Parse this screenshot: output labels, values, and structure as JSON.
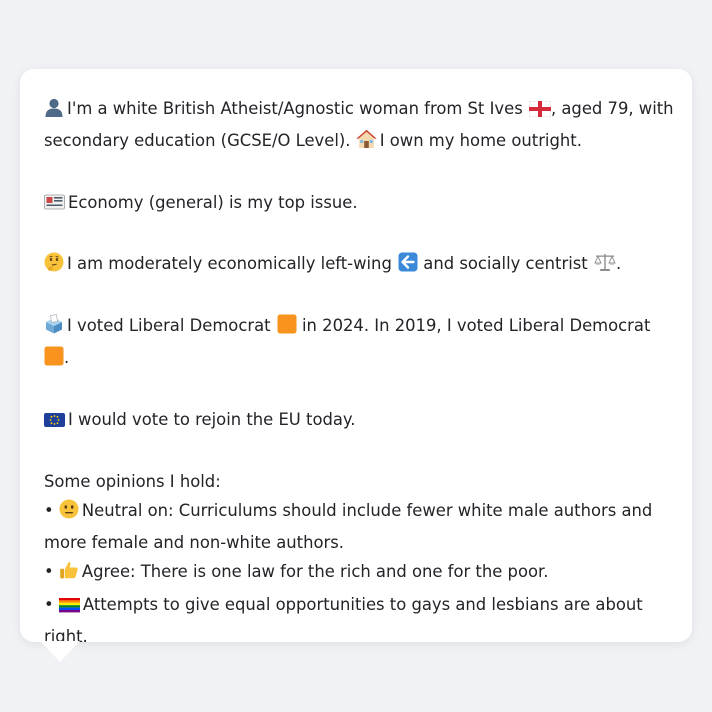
{
  "persona": {
    "intro_part1": "I'm a white British Atheist/Agnostic woman from St Ives",
    "intro_part2": ", aged 79, with",
    "intro_line2_part1": "secondary education (GCSE/O Level).",
    "intro_line2_part2": "I own my home outright.",
    "top_issue": "Economy (general) is my top issue.",
    "ideology_part1": "I am moderately economically left-wing",
    "ideology_part2": "and socially centrist",
    "ideology_end": ".",
    "vote_part1": "I voted Liberal Democrat",
    "vote_part2": "in 2024. In 2019, I voted Liberal Democrat",
    "vote_end": ".",
    "eu_statement": "I would vote to rejoin the EU today.",
    "opinions_header": "Some opinions I hold:",
    "opinions": [
      {
        "bullet": "•",
        "line1": "Neutral on: Curriculums should include fewer white male authors and",
        "line2": "more female and non-white authors."
      },
      {
        "bullet": "•",
        "line1": "Agree: There is one law for the rich and one for the poor."
      },
      {
        "bullet": "•",
        "line1": "Attempts to give equal opportunities to gays and lesbians are about",
        "line2": "right."
      }
    ]
  },
  "icons": {
    "person": "person-silhouette-icon",
    "flag_england": "flag-england-icon",
    "house": "house-icon",
    "newspaper": "newspaper-icon",
    "thinking": "thinking-face-icon",
    "left_arrow": "left-arrow-icon",
    "scales": "balance-scale-icon",
    "ballot": "ballot-box-icon",
    "party_square": "orange-square-icon",
    "eu_flag": "eu-flag-icon",
    "neutral_face": "neutral-face-icon",
    "thumbs_up": "thumbs-up-icon",
    "rainbow_flag": "rainbow-flag-icon"
  },
  "colors": {
    "page_bg": "#f0f2f5",
    "bubble_bg": "#ffffff",
    "text": "#222428",
    "lib_dem_orange": "#f7931e",
    "eu_blue": "#1f3f9a",
    "arrow_blue": "#3b8ad9"
  }
}
